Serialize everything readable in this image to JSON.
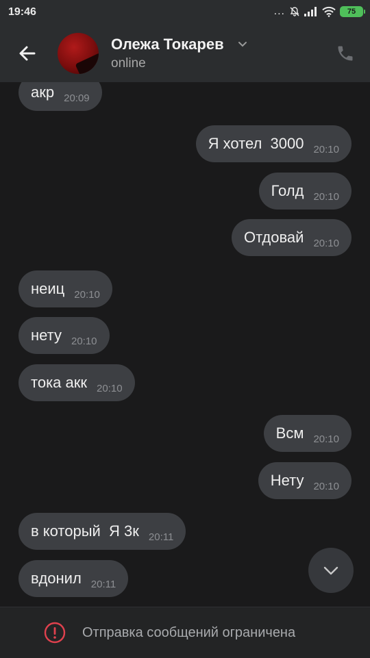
{
  "status_bar": {
    "time": "19:46",
    "dots": "...",
    "battery": "75",
    "icons": [
      "mute-bell-icon",
      "signal-icon",
      "wifi-icon",
      "battery-icon"
    ]
  },
  "header": {
    "name": "Олежа Токарев",
    "status": "online",
    "icons": [
      "back-arrow-icon",
      "chevron-down-icon",
      "phone-icon"
    ]
  },
  "messages": [
    {
      "dir": "in",
      "text": "акр",
      "time": "20:09"
    },
    {
      "dir": "out",
      "text": "Я хотел  3000",
      "time": "20:10"
    },
    {
      "dir": "out",
      "text": "Голд",
      "time": "20:10"
    },
    {
      "dir": "out",
      "text": "Отдовай",
      "time": "20:10"
    },
    {
      "dir": "in",
      "text": "неиц",
      "time": "20:10"
    },
    {
      "dir": "in",
      "text": "нету",
      "time": "20:10"
    },
    {
      "dir": "in",
      "text": "тока акк",
      "time": "20:10"
    },
    {
      "dir": "out",
      "text": "Всм",
      "time": "20:10"
    },
    {
      "dir": "out",
      "text": "Нету",
      "time": "20:10"
    },
    {
      "dir": "in",
      "text": "в который  Я 3к",
      "time": "20:11"
    },
    {
      "dir": "in",
      "text": "вдонил",
      "time": "20:11"
    }
  ],
  "footer": {
    "restricted_text": "Отправка сообщений ограничена",
    "icon": "alert-circle-icon"
  },
  "colors": {
    "background": "#1a1a1b",
    "header": "#2b2d2f",
    "bubble": "#3d3f43",
    "alert": "#e0414e",
    "battery": "#4fbf5a"
  }
}
